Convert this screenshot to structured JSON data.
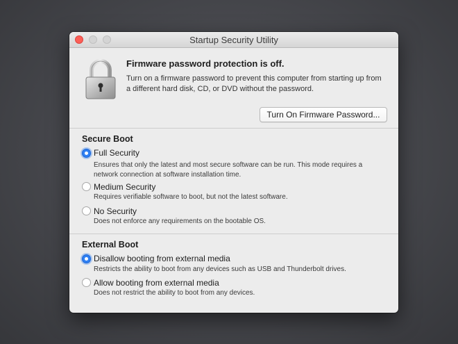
{
  "window": {
    "title": "Startup Security Utility"
  },
  "firmware": {
    "title": "Firmware password protection is off.",
    "description": "Turn on a firmware password to prevent this computer from starting up from a different hard disk, CD, or DVD without the password.",
    "button_label": "Turn On Firmware Password..."
  },
  "secure_boot": {
    "title": "Secure Boot",
    "options": [
      {
        "label": "Full Security",
        "description": "Ensures that only the latest and most secure software can be run. This mode requires a network connection at software installation time.",
        "selected": true
      },
      {
        "label": "Medium Security",
        "description": "Requires verifiable software to boot, but not the latest software.",
        "selected": false
      },
      {
        "label": "No Security",
        "description": "Does not enforce any requirements on the bootable OS.",
        "selected": false
      }
    ]
  },
  "external_boot": {
    "title": "External Boot",
    "options": [
      {
        "label": "Disallow booting from external media",
        "description": "Restricts the ability to boot from any devices such as USB and Thunderbolt drives.",
        "selected": true
      },
      {
        "label": "Allow booting from external media",
        "description": "Does not restrict the ability to boot from any devices.",
        "selected": false
      }
    ]
  },
  "colors": {
    "accent": "#2f7ff2",
    "close": "#fc5f57"
  },
  "icons": {
    "lock": "padlock-icon"
  }
}
